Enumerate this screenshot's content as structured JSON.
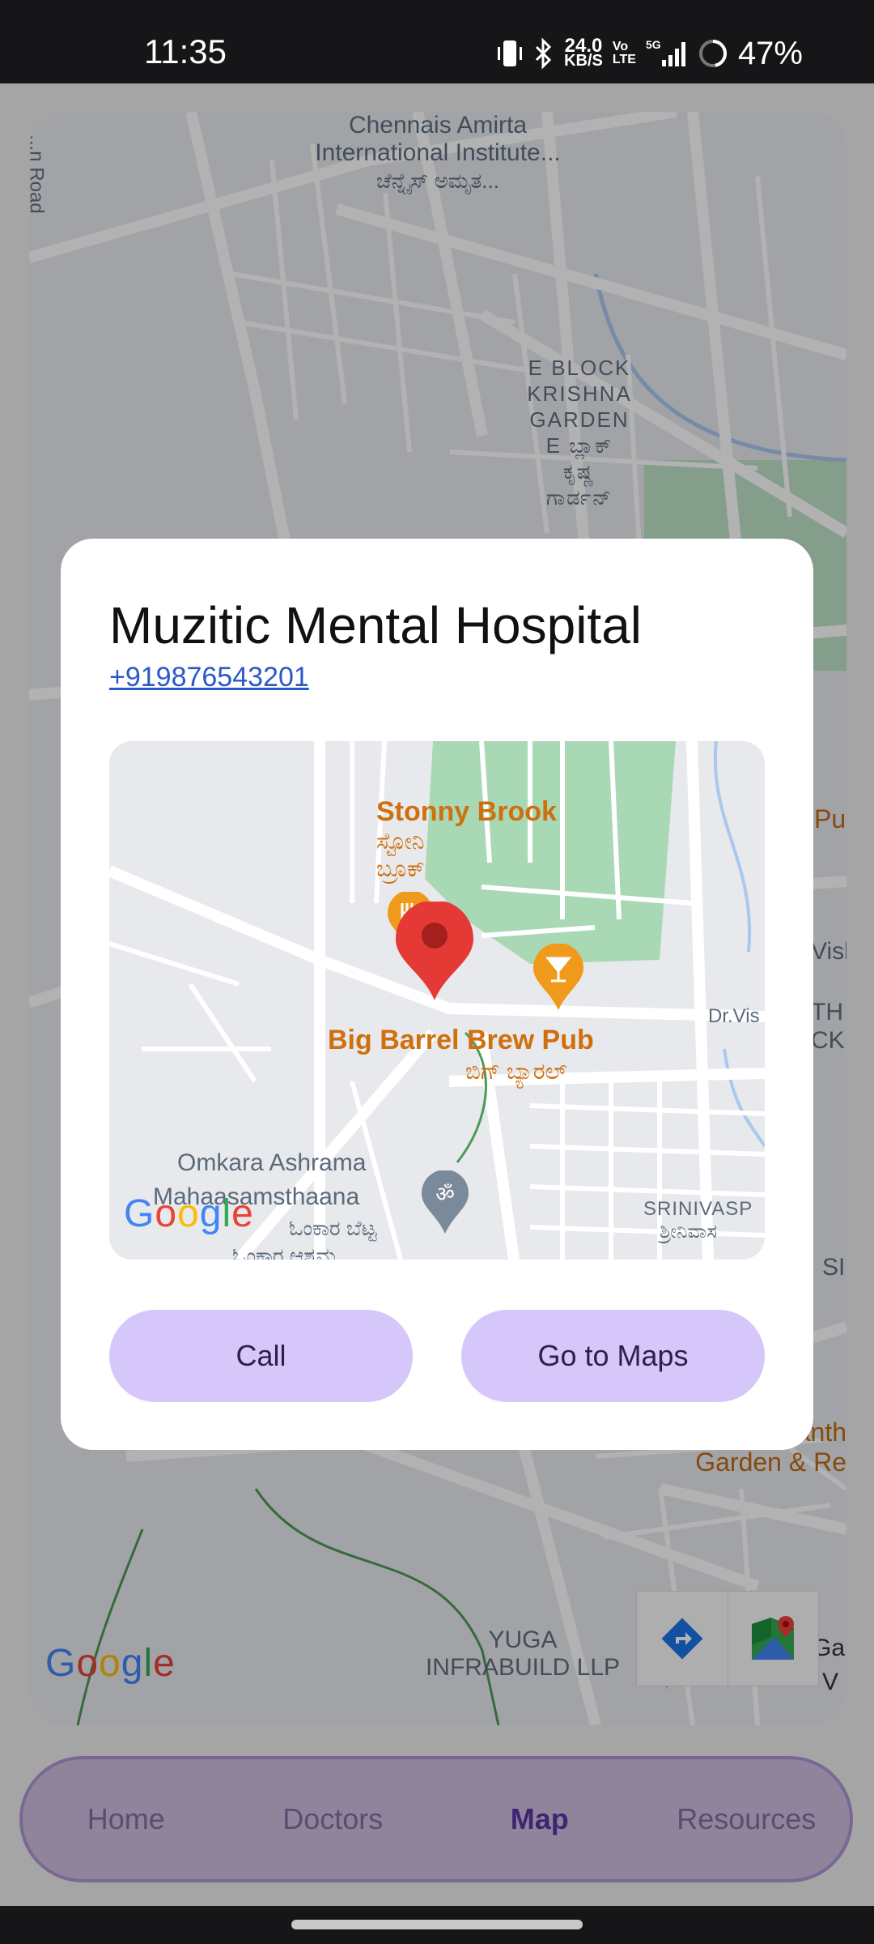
{
  "status_bar": {
    "time": "11:35",
    "net_speed_value": "24.0",
    "net_speed_unit": "KB/S",
    "volte_top": "Vo",
    "volte_bottom": "LTE",
    "network": "5G",
    "battery": "47%"
  },
  "background_map": {
    "labels": {
      "institute_1": "Chennais Amirta",
      "institute_2": "International Institute...",
      "institute_3": "ಚೆನ್ನೈಸ್ ಅಮೃತ...",
      "road": "...n Road",
      "block_1": "E BLOCK",
      "block_2": "KRISHNA",
      "block_3": "GARDEN",
      "block_4": "E ಬ್ಲಾಕ್",
      "block_5": "ಕೃಷ್ಣ",
      "block_6": "ಗಾರ್ಡನ್",
      "pub_partial": "Pu",
      "vish_partial": "Visl",
      "th_partial": "TH",
      "ck_partial": "CK",
      "si_partial": "SI",
      "garden_1": "anth",
      "garden_2": "Garden & Re",
      "yuga_1": "YUGA",
      "yuga_2": "INFRABUILD LLP",
      "ga_partial": "Ga",
      "v_partial": "V"
    },
    "google_logo": [
      "G",
      "o",
      "o",
      "g",
      "l",
      "e"
    ]
  },
  "dialog": {
    "title": "Muzitic Mental Hospital",
    "phone": "+919876543201",
    "mini_map": {
      "stonny": "Stonny Brook",
      "stonny_kn_1": "ಸ್ಟೋನಿ",
      "stonny_kn_2": "ಬ್ರೂಕ್",
      "pub": "Big Barrel Brew Pub",
      "pub_kn": "ಬಿಗ್ ಬ್ಯಾರಲ್",
      "omkara_1": "Omkara Ashrama",
      "omkara_2": "Mahaasamsthaana",
      "omkara_kn_1": "ಓಂಕಾರ ಬೆಟ್ಟ",
      "omkara_kn_2": "ಓಂಕಾರ ಆಶ್ರಮ",
      "dr_vis": "Dr.Vis",
      "srinivas": "SRINIVASP",
      "srinivas_kn": "ಶ್ರೀನಿವಾಸ"
    },
    "call_label": "Call",
    "maps_label": "Go to Maps"
  },
  "bottom_nav": {
    "items": [
      {
        "label": "Home",
        "active": false
      },
      {
        "label": "Doctors",
        "active": false
      },
      {
        "label": "Map",
        "active": true
      },
      {
        "label": "Resources",
        "active": false
      }
    ]
  },
  "colors": {
    "accent": "#d6c7fa",
    "active_nav": "#5b35a3",
    "marker": "#e53935",
    "poi_orange": "#f09a1b",
    "park": "#a8d8b4"
  }
}
